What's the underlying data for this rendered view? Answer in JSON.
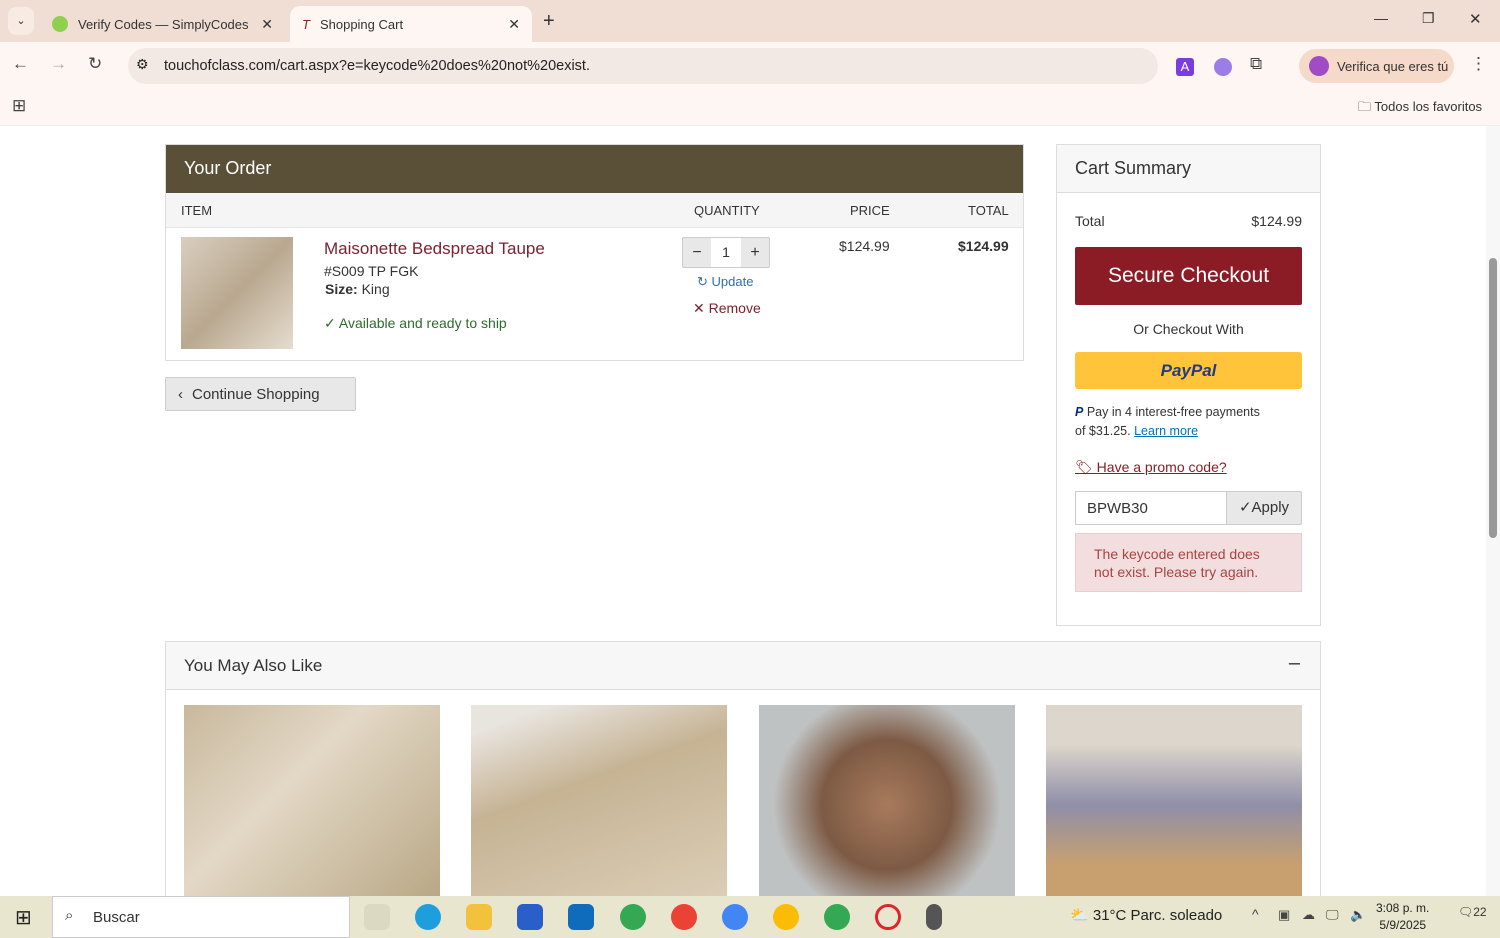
{
  "browser": {
    "tabs": [
      {
        "title": "Verify Codes — SimplyCodes"
      },
      {
        "title": "Shopping Cart"
      }
    ],
    "url": "touchofclass.com/cart.aspx?e=keycode%20does%20not%20exist.",
    "profile_label": "Verifica que eres tú",
    "bookmarks_label": "Todos los favoritos"
  },
  "order": {
    "title": "Your Order",
    "columns": [
      "ITEM",
      "QUANTITY",
      "PRICE",
      "TOTAL"
    ],
    "item": {
      "name": "Maisonette Bedspread Taupe",
      "sku": "#S009 TP FGK",
      "size_label": "Size:",
      "size": "King",
      "availability": "Available and ready to ship",
      "quantity": "1",
      "price": "$124.99",
      "total": "$124.99",
      "update": "Update",
      "remove": "Remove"
    },
    "continue": "Continue Shopping"
  },
  "summary": {
    "title": "Cart Summary",
    "total_label": "Total",
    "total": "$124.99",
    "checkout": "Secure Checkout",
    "or": "Or Checkout With",
    "paypal": "PayPal",
    "paylater": "Pay in 4 interest-free payments",
    "paylater2": "of $31.25.",
    "learn": "Learn more",
    "promo_link": "Have a promo code?",
    "promo_value": "BPWB30",
    "apply": "Apply",
    "error": "The keycode entered does not exist. Please try again."
  },
  "also": {
    "title": "You May Also Like",
    "collapse": "–"
  },
  "taskbar": {
    "search": "Buscar",
    "weather": "31°C  Parc. soleado",
    "time": "3:08 p. m.",
    "date": "5/9/2025",
    "notifications": "22"
  }
}
